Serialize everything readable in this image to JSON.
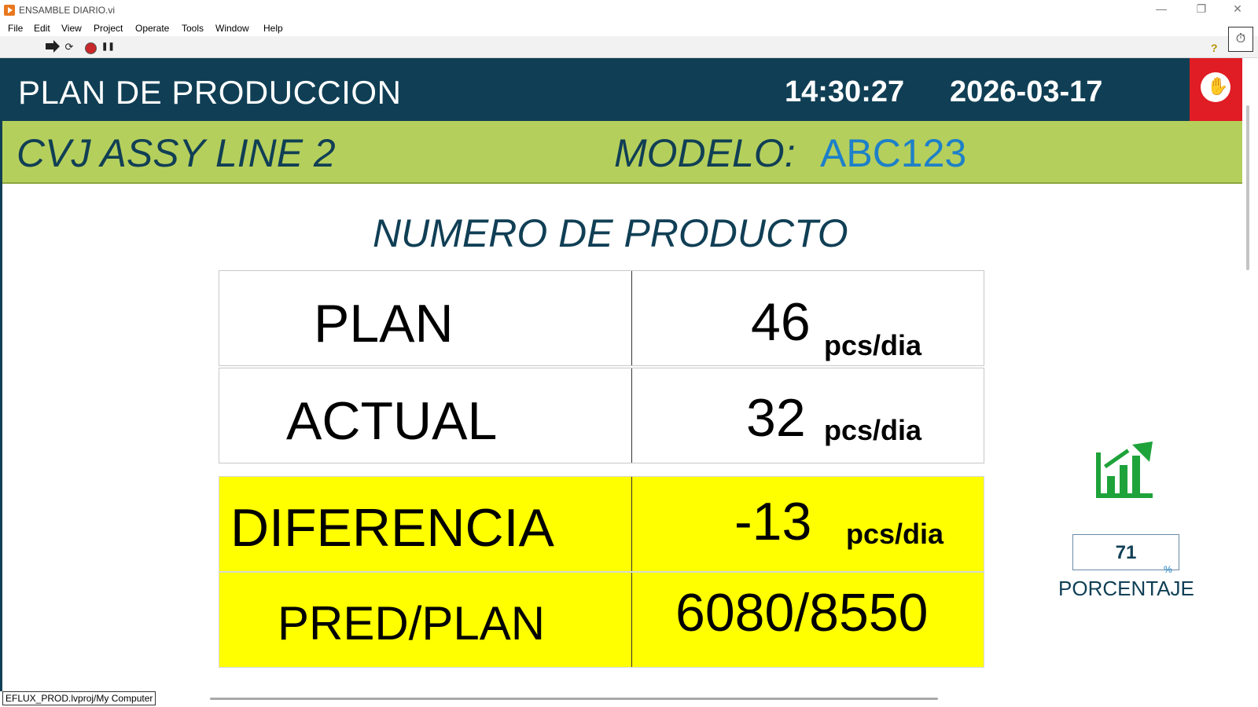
{
  "window": {
    "title": "ENSAMBLE DIARIO.vi",
    "minimize": "—",
    "restore": "❐",
    "close": "✕"
  },
  "menu": [
    "File",
    "Edit",
    "View",
    "Project",
    "Operate",
    "Tools",
    "Window",
    "Help"
  ],
  "toolbar": {
    "run_continuous_icon": "⟳",
    "pause_icon": "❚❚",
    "help": "?"
  },
  "header": {
    "title": "PLAN DE PRODUCCION",
    "time": "14:30:27",
    "date": "2026-03-17"
  },
  "subheader": {
    "line": "CVJ ASSY LINE 2",
    "modelo_label": "MODELO:",
    "modelo_value": "ABC123"
  },
  "section_title": "NUMERO DE PRODUCTO",
  "rows": [
    {
      "label": "PLAN",
      "value": "46",
      "unit": "pcs/dia"
    },
    {
      "label": "ACTUAL",
      "value": "32",
      "unit": "pcs/dia"
    },
    {
      "label": "DIFERENCIA",
      "value": "-13",
      "unit": "pcs/dia"
    },
    {
      "label": "PRED/PLAN",
      "value": "6080/8550",
      "unit": ""
    }
  ],
  "percentage": {
    "value": "71",
    "unit": "%",
    "label": "PORCENTAJE"
  },
  "status_path": "EFLUX_PROD.lvproj/My Computer",
  "colors": {
    "header": "#103f55",
    "subheader": "#b5cf5c",
    "highlight": "#ffff00",
    "accent": "#1d80c9",
    "stop": "#e01c24",
    "icon_green": "#1ea33a"
  }
}
